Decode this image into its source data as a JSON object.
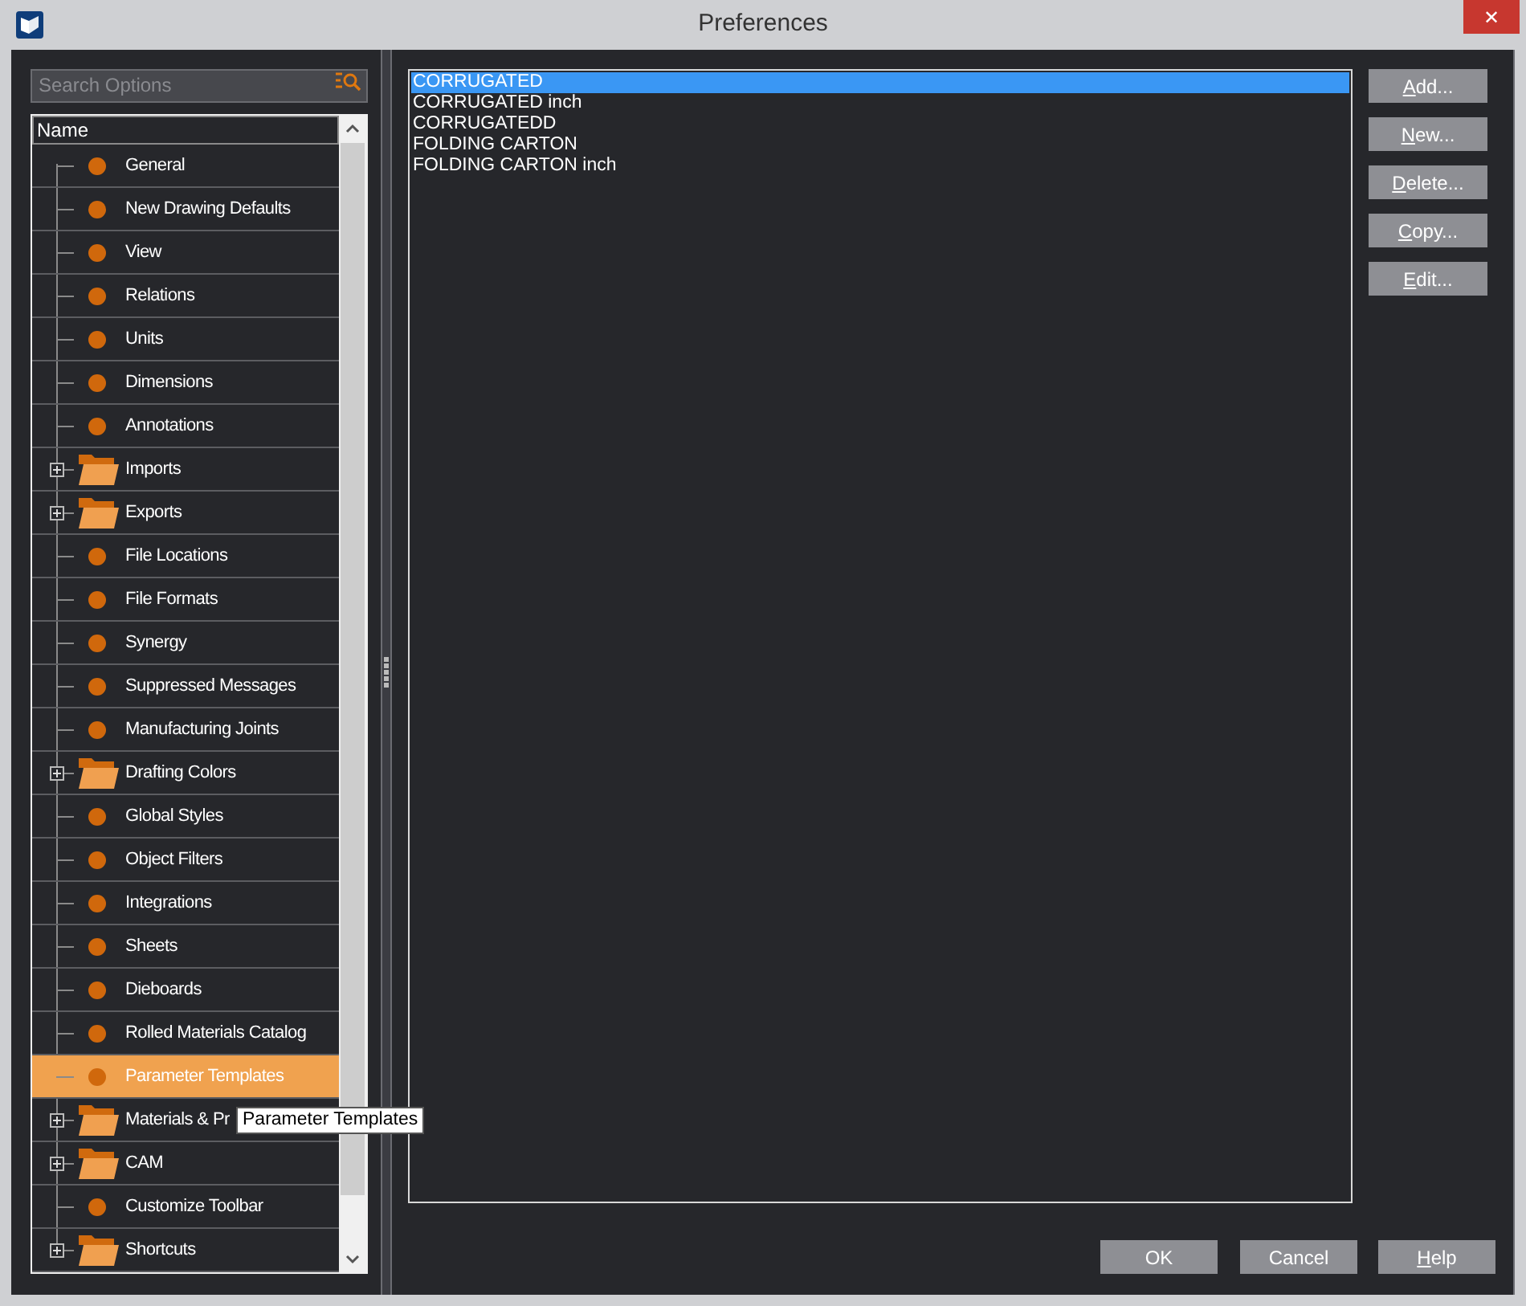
{
  "window": {
    "title": "Preferences",
    "close": "✕"
  },
  "search": {
    "placeholder": "Search Options"
  },
  "tree": {
    "column": "Name",
    "items": [
      {
        "label": "General",
        "kind": "leaf",
        "selected": false
      },
      {
        "label": "New Drawing Defaults",
        "kind": "leaf",
        "selected": false
      },
      {
        "label": "View",
        "kind": "leaf",
        "selected": false
      },
      {
        "label": "Relations",
        "kind": "leaf",
        "selected": false
      },
      {
        "label": "Units",
        "kind": "leaf",
        "selected": false
      },
      {
        "label": "Dimensions",
        "kind": "leaf",
        "selected": false
      },
      {
        "label": "Annotations",
        "kind": "leaf",
        "selected": false
      },
      {
        "label": "Imports",
        "kind": "folder",
        "selected": false
      },
      {
        "label": "Exports",
        "kind": "folder",
        "selected": false
      },
      {
        "label": "File Locations",
        "kind": "leaf",
        "selected": false
      },
      {
        "label": "File Formats",
        "kind": "leaf",
        "selected": false
      },
      {
        "label": "Synergy",
        "kind": "leaf",
        "selected": false
      },
      {
        "label": "Suppressed Messages",
        "kind": "leaf",
        "selected": false
      },
      {
        "label": "Manufacturing Joints",
        "kind": "leaf",
        "selected": false
      },
      {
        "label": "Drafting Colors",
        "kind": "folder",
        "selected": false
      },
      {
        "label": "Global Styles",
        "kind": "leaf",
        "selected": false
      },
      {
        "label": "Object Filters",
        "kind": "leaf",
        "selected": false
      },
      {
        "label": "Integrations",
        "kind": "leaf",
        "selected": false
      },
      {
        "label": "Sheets",
        "kind": "leaf",
        "selected": false
      },
      {
        "label": "Dieboards",
        "kind": "leaf",
        "selected": false
      },
      {
        "label": "Rolled Materials Catalog",
        "kind": "leaf",
        "selected": false
      },
      {
        "label": "Parameter Templates",
        "kind": "leaf",
        "selected": true
      },
      {
        "label": "Materials & Pr",
        "kind": "folder",
        "selected": false
      },
      {
        "label": "CAM",
        "kind": "folder",
        "selected": false
      },
      {
        "label": "Customize Toolbar",
        "kind": "leaf",
        "selected": false
      },
      {
        "label": "Shortcuts",
        "kind": "folder",
        "selected": false
      }
    ]
  },
  "tooltip": "Parameter Templates",
  "templates": [
    {
      "label": "CORRUGATED",
      "selected": true
    },
    {
      "label": "CORRUGATED inch",
      "selected": false
    },
    {
      "label": "CORRUGATEDD",
      "selected": false
    },
    {
      "label": "FOLDING CARTON",
      "selected": false
    },
    {
      "label": "FOLDING CARTON inch",
      "selected": false
    }
  ],
  "side_buttons": [
    {
      "label": "Add...",
      "underline_first": true
    },
    {
      "label": "New...",
      "underline_first": true
    },
    {
      "label": "Delete...",
      "underline_first": true
    },
    {
      "label": "Copy...",
      "underline_first": true
    },
    {
      "label": "Edit...",
      "underline_first": true
    }
  ],
  "footer_buttons": [
    {
      "label": "OK",
      "underline_first": false
    },
    {
      "label": "Cancel",
      "underline_first": false
    },
    {
      "label": "Help",
      "underline_first": true
    }
  ]
}
